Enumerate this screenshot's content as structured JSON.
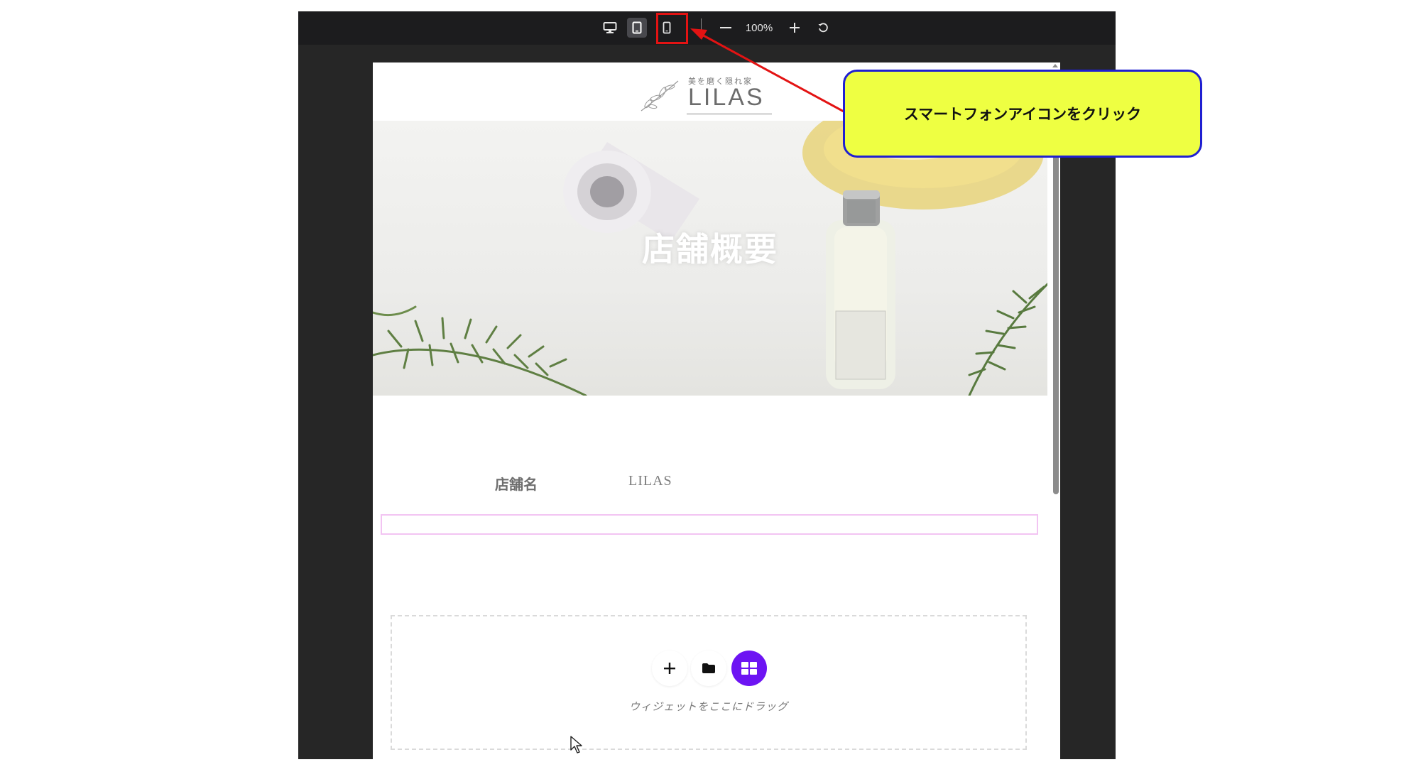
{
  "toolbar": {
    "zoom_level": "100%",
    "icons": [
      "desktop-icon",
      "tablet-icon",
      "mobile-icon",
      "minus-icon",
      "plus-icon",
      "reset-icon"
    ],
    "active_device": "tablet"
  },
  "site": {
    "logo": {
      "tagline": "美を磨く隠れ家",
      "name": "LILAS"
    },
    "hero": {
      "title": "店舗概要"
    },
    "info": {
      "label": "店舗名",
      "value": "LILAS"
    },
    "dropzone": {
      "hint": "ウィジェットをここにドラッグ"
    }
  },
  "annotation": {
    "callout": "スマートフォンアイコンをクリック",
    "colors": {
      "callout_fill": "#eeff42",
      "callout_border": "#1f1fd1",
      "arrow": "#e31313"
    }
  },
  "colors": {
    "toolbar_bg": "#1c1c1e",
    "editor_bg": "#262626",
    "accent_purple": "#6d14f3",
    "selection_pink": "#f2c4f2"
  }
}
